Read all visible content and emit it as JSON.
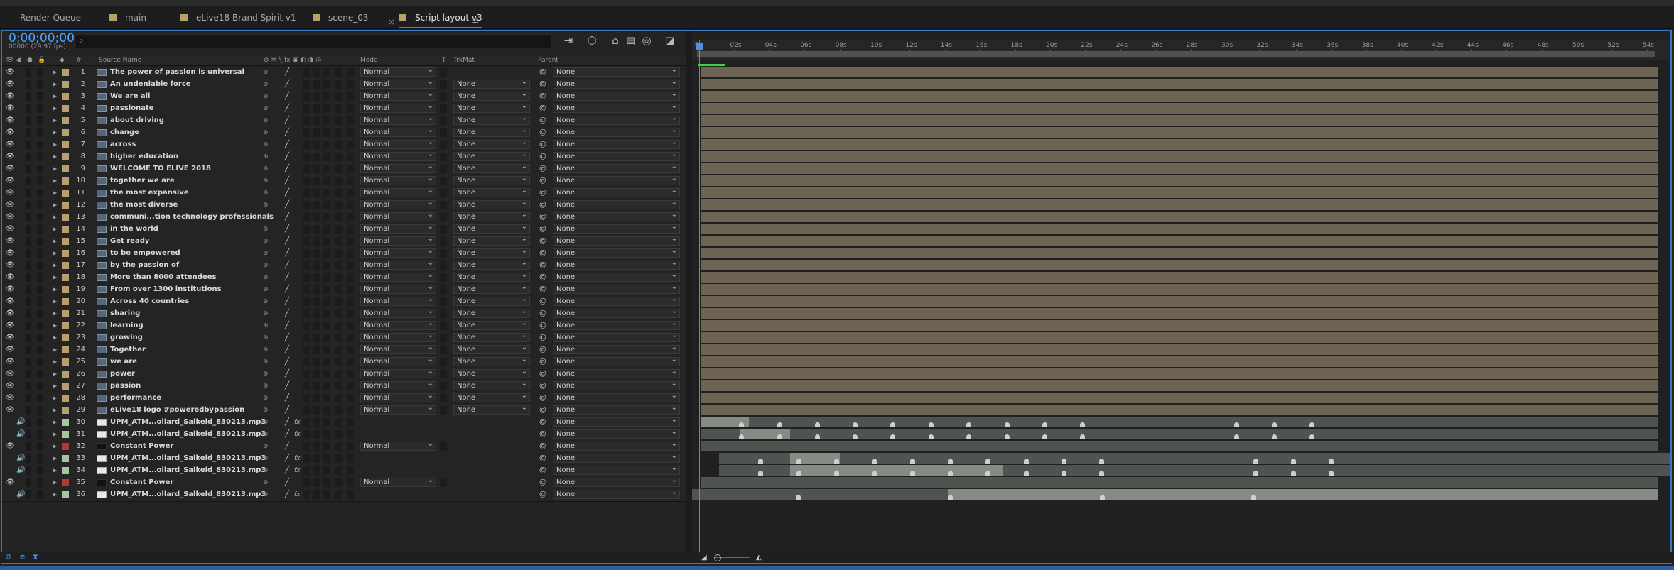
{
  "tabs": [
    {
      "label": "Render Queue",
      "swatch": false,
      "active": false
    },
    {
      "label": "main",
      "swatch": true,
      "active": false
    },
    {
      "label": "eLive18 Brand Spirit v1",
      "swatch": true,
      "active": false
    },
    {
      "label": "scene_03",
      "swatch": true,
      "active": false
    },
    {
      "label": "Script layout v3",
      "swatch": true,
      "active": true
    }
  ],
  "tab_close": "×",
  "tab_menu": "≡",
  "timecode": "0;00;00;00",
  "fps": "00000 (29.97 fps)",
  "search_icon": "⌕",
  "search_value": "",
  "columns": {
    "hash": "#",
    "source": "Source Name",
    "mode": "Mode",
    "t": "T",
    "trkmat": "TrkMat",
    "parent": "Parent"
  },
  "ruler_ticks": [
    "0s",
    "02s",
    "04s",
    "06s",
    "08s",
    "10s",
    "12s",
    "14s",
    "16s",
    "18s",
    "20s",
    "22s",
    "24s",
    "26s",
    "28s",
    "30s",
    "32s",
    "34s",
    "36s",
    "38s",
    "40s",
    "42s",
    "44s",
    "46s",
    "48s",
    "50s",
    "52s",
    "54s"
  ],
  "layers": [
    {
      "num": "1",
      "name": "The power of passion is universal",
      "type": "text",
      "mode": "Normal",
      "trkmat": "",
      "parent": "None"
    },
    {
      "num": "2",
      "name": "An undeniable force",
      "type": "text",
      "mode": "Normal",
      "trkmat": "None",
      "parent": "None"
    },
    {
      "num": "3",
      "name": "We are all",
      "type": "text",
      "mode": "Normal",
      "trkmat": "None",
      "parent": "None"
    },
    {
      "num": "4",
      "name": "passionate",
      "type": "text",
      "mode": "Normal",
      "trkmat": "None",
      "parent": "None"
    },
    {
      "num": "5",
      "name": "about driving",
      "type": "text",
      "mode": "Normal",
      "trkmat": "None",
      "parent": "None"
    },
    {
      "num": "6",
      "name": "change",
      "type": "text",
      "mode": "Normal",
      "trkmat": "None",
      "parent": "None"
    },
    {
      "num": "7",
      "name": "across",
      "type": "text",
      "mode": "Normal",
      "trkmat": "None",
      "parent": "None"
    },
    {
      "num": "8",
      "name": "higher education",
      "type": "text",
      "mode": "Normal",
      "trkmat": "None",
      "parent": "None"
    },
    {
      "num": "9",
      "name": "WELCOME TO ELIVE 2018",
      "type": "text",
      "mode": "Normal",
      "trkmat": "None",
      "parent": "None"
    },
    {
      "num": "10",
      "name": "together we are",
      "type": "text",
      "mode": "Normal",
      "trkmat": "None",
      "parent": "None"
    },
    {
      "num": "11",
      "name": " the most expansive",
      "type": "text",
      "mode": "Normal",
      "trkmat": "None",
      "parent": "None"
    },
    {
      "num": "12",
      "name": " the most diverse",
      "type": "text",
      "mode": "Normal",
      "trkmat": "None",
      "parent": "None"
    },
    {
      "num": "13",
      "name": "communi...tion technology professionals",
      "type": "text",
      "mode": "Normal",
      "trkmat": "None",
      "parent": "None"
    },
    {
      "num": "14",
      "name": "in the world",
      "type": "text",
      "mode": "Normal",
      "trkmat": "None",
      "parent": "None"
    },
    {
      "num": "15",
      "name": "Get ready",
      "type": "text",
      "mode": "Normal",
      "trkmat": "None",
      "parent": "None"
    },
    {
      "num": "16",
      "name": "to be empowered",
      "type": "text",
      "mode": "Normal",
      "trkmat": "None",
      "parent": "None"
    },
    {
      "num": "17",
      "name": "by the passion of",
      "type": "text",
      "mode": "Normal",
      "trkmat": "None",
      "parent": "None"
    },
    {
      "num": "18",
      "name": "More than 8000 attendees",
      "type": "text",
      "mode": "Normal",
      "trkmat": "None",
      "parent": "None"
    },
    {
      "num": "19",
      "name": "From over 1300 institutions",
      "type": "text",
      "mode": "Normal",
      "trkmat": "None",
      "parent": "None"
    },
    {
      "num": "20",
      "name": "Across 40 countries",
      "type": "text",
      "mode": "Normal",
      "trkmat": "None",
      "parent": "None"
    },
    {
      "num": "21",
      "name": "sharing",
      "type": "text",
      "mode": "Normal",
      "trkmat": "None",
      "parent": "None"
    },
    {
      "num": "22",
      "name": "learning",
      "type": "text",
      "mode": "Normal",
      "trkmat": "None",
      "parent": "None"
    },
    {
      "num": "23",
      "name": "growing",
      "type": "text",
      "mode": "Normal",
      "trkmat": "None",
      "parent": "None"
    },
    {
      "num": "24",
      "name": "Together",
      "type": "text",
      "mode": "Normal",
      "trkmat": "None",
      "parent": "None"
    },
    {
      "num": "25",
      "name": "we are",
      "type": "text",
      "mode": "Normal",
      "trkmat": "None",
      "parent": "None"
    },
    {
      "num": "26",
      "name": "power",
      "type": "text",
      "mode": "Normal",
      "trkmat": "None",
      "parent": "None"
    },
    {
      "num": "27",
      "name": "passion",
      "type": "text",
      "mode": "Normal",
      "trkmat": "None",
      "parent": "None"
    },
    {
      "num": "28",
      "name": "performance",
      "type": "text",
      "mode": "Normal",
      "trkmat": "None",
      "parent": "None"
    },
    {
      "num": "29",
      "name": "eLive18 logo #poweredbypassion",
      "type": "text",
      "mode": "Normal",
      "trkmat": "None",
      "parent": "None"
    },
    {
      "num": "30",
      "name": "UPM_ATM...ollard_Salkeld_830213.mp3",
      "type": "audio",
      "mode": "",
      "trkmat": "",
      "parent": "None"
    },
    {
      "num": "31",
      "name": "UPM_ATM...ollard_Salkeld_830213.mp3",
      "type": "audio",
      "mode": "",
      "trkmat": "",
      "parent": "None"
    },
    {
      "num": "32",
      "name": "Constant Power",
      "type": "solid",
      "mode": "Normal",
      "trkmat": "",
      "parent": "None"
    },
    {
      "num": "33",
      "name": "UPM_ATM...ollard_Salkeld_830213.mp3",
      "type": "audio",
      "mode": "",
      "trkmat": "",
      "parent": "None"
    },
    {
      "num": "34",
      "name": "UPM_ATM...ollard_Salkeld_830213.mp3",
      "type": "audio",
      "mode": "",
      "trkmat": "",
      "parent": "None"
    },
    {
      "num": "35",
      "name": "Constant Power",
      "type": "solid",
      "mode": "Normal",
      "trkmat": "",
      "parent": "None"
    },
    {
      "num": "36",
      "name": "UPM_ATM...ollard_Salkeld_830213.mp3",
      "type": "audio",
      "mode": "",
      "trkmat": "",
      "parent": "None"
    }
  ],
  "colors": {
    "accent": "#4a8fe0",
    "text_layer_label": "#b89f6e",
    "audio_label": "#a7c4a0",
    "solid_label": "#b33a3a",
    "text_bar": "#6e6453",
    "audio_bar": "#4e5450",
    "audio_bar_hi": "#858b85"
  }
}
